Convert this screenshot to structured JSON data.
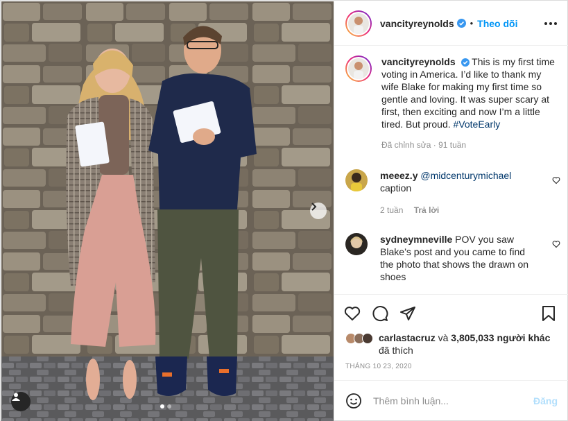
{
  "post": {
    "username": "vancityreynolds",
    "follow_label": "Theo dõi",
    "separator": "•",
    "caption": "This is my first time voting in America. I’d like to thank my wife Blake for making my first time so gentle and loving. It was super scary at first, then exciting and now I’m a little tired. But proud.",
    "hashtag": "#VoteEarly",
    "caption_meta": "Đã chỉnh sửa · 91 tuần",
    "date": "THÁNG 10 23, 2020"
  },
  "comments": [
    {
      "username": "meeez.y",
      "mention": "@midcenturymichael",
      "text": "caption",
      "age": "2 tuần",
      "reply_label": "Trả lời"
    },
    {
      "username": "sydneymneville",
      "text": "POV you saw Blake’s post and you came to find the photo that shows the drawn on shoes"
    }
  ],
  "likes": {
    "user": "carlastacruz",
    "connector": "và",
    "count_text": "3,805,033 người khác",
    "suffix": "đã thích"
  },
  "add_comment": {
    "placeholder": "Thêm bình luận...",
    "post_label": "Đăng"
  },
  "carousel": {
    "total": 2,
    "active": 1
  },
  "icons": [
    "verified-badge-icon",
    "more-options-icon",
    "heart-icon",
    "comment-icon",
    "share-icon",
    "bookmark-icon",
    "emoji-icon",
    "chevron-right-icon",
    "user-tag-icon"
  ],
  "colors": {
    "link_blue": "#0095f6",
    "verified": "#3897f0",
    "muted": "#8e8e8e",
    "post_disabled": "#b2dffc"
  }
}
